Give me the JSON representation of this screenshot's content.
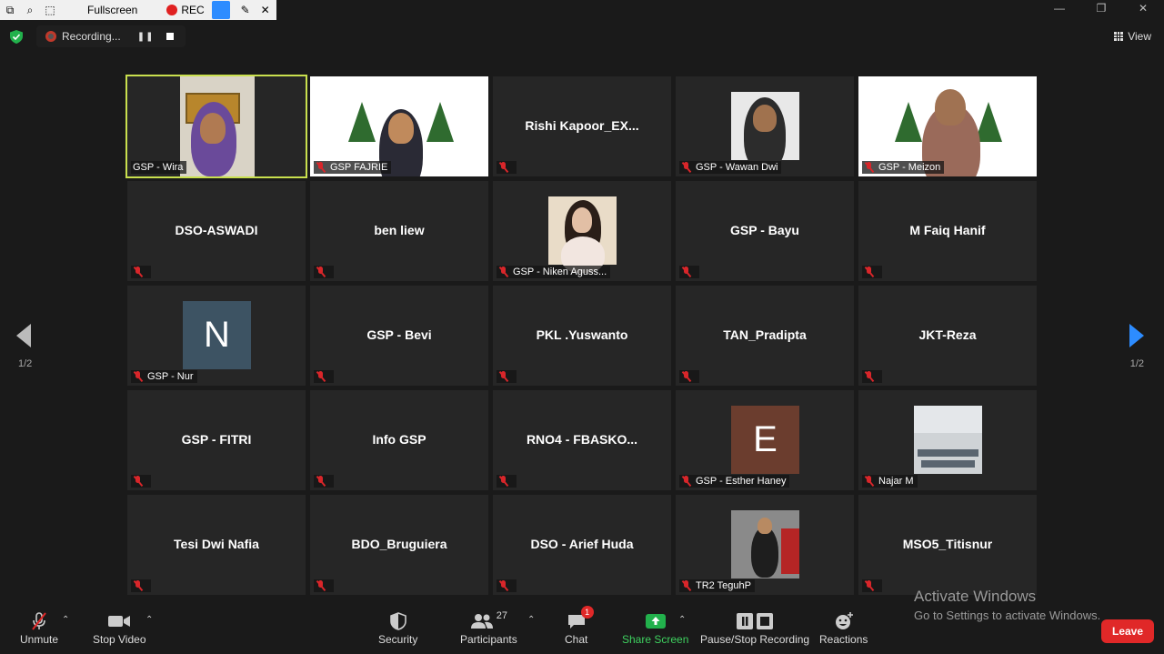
{
  "capture_toolbar": {
    "fullscreen_label": "Fullscreen",
    "rec_label": "REC"
  },
  "recording": {
    "status": "Recording..."
  },
  "view_button": "View",
  "pagination": {
    "left": "1/2",
    "right": "1/2"
  },
  "tiles": [
    {
      "label": "GSP - Wira",
      "type": "video",
      "active": true
    },
    {
      "label": "GSP FAJRIE",
      "type": "video"
    },
    {
      "name": "Rishi  Kapoor_EX...",
      "type": "name"
    },
    {
      "label": "GSP - Wawan Dwi",
      "type": "photo"
    },
    {
      "label": "GSP - Meizon",
      "type": "video"
    },
    {
      "name": "DSO-ASWADI",
      "type": "name"
    },
    {
      "name": "ben liew",
      "type": "name"
    },
    {
      "label": "GSP - Niken Aguss...",
      "type": "photo"
    },
    {
      "name": "GSP - Bayu",
      "type": "name"
    },
    {
      "name": "M Faiq Hanif",
      "type": "name"
    },
    {
      "label": "GSP - Nur",
      "type": "letter",
      "letter": "N",
      "color": "#3d5363"
    },
    {
      "name": "GSP - Bevi",
      "type": "name"
    },
    {
      "name": "PKL .Yuswanto",
      "type": "name"
    },
    {
      "name": "TAN_Pradipta",
      "type": "name"
    },
    {
      "name": "JKT-Reza",
      "type": "name"
    },
    {
      "name": "GSP - FITRI",
      "type": "name"
    },
    {
      "name": "Info GSP",
      "type": "name"
    },
    {
      "name": "RNO4  - FBASKO...",
      "type": "name"
    },
    {
      "label": "GSP - Esther Haney",
      "type": "letter",
      "letter": "E",
      "color": "#6b3d2e"
    },
    {
      "label": "Najar M",
      "type": "photo"
    },
    {
      "name": "Tesi Dwi Nafia",
      "type": "name"
    },
    {
      "name": "BDO_Bruguiera",
      "type": "name"
    },
    {
      "name": "DSO - Arief Huda",
      "type": "name"
    },
    {
      "label": "TR2 TeguhP",
      "type": "photo"
    },
    {
      "name": "MSO5_Titisnur",
      "type": "name"
    }
  ],
  "toolbar": {
    "unmute": "Unmute",
    "stop_video": "Stop Video",
    "security": "Security",
    "participants": "Participants",
    "participants_count": "27",
    "chat": "Chat",
    "chat_badge": "1",
    "share_screen": "Share Screen",
    "pause_stop_recording": "Pause/Stop Recording",
    "reactions": "Reactions",
    "leave": "Leave"
  },
  "watermark": {
    "title": "Activate Windows",
    "subtitle": "Go to Settings to activate Windows."
  },
  "colors": {
    "accent_green": "#22b14c",
    "active_outline": "#c9e04e",
    "leave_red": "#e02828",
    "next_arrow": "#2d8cff"
  }
}
